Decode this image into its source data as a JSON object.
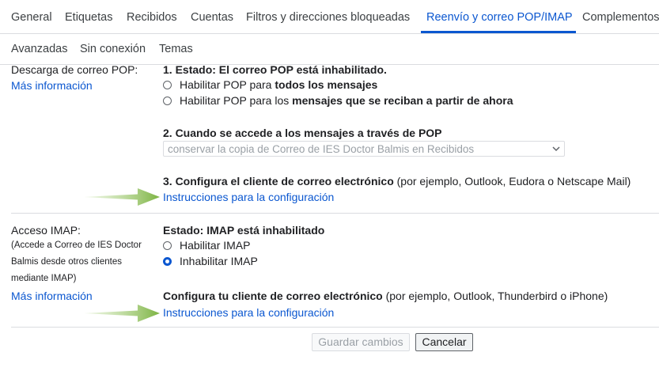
{
  "tabs": [
    {
      "label": "General",
      "active": false
    },
    {
      "label": "Etiquetas",
      "active": false
    },
    {
      "label": "Recibidos",
      "active": false
    },
    {
      "label": "Cuentas",
      "active": false
    },
    {
      "label": "Filtros y direcciones bloqueadas",
      "active": false
    },
    {
      "label": "Reenvío y correo POP/IMAP",
      "active": true
    },
    {
      "label": "Complementos",
      "active": false
    }
  ],
  "tabs_row2": [
    {
      "label": "Avanzadas"
    },
    {
      "label": "Sin conexión"
    },
    {
      "label": "Temas"
    }
  ],
  "pop": {
    "section_label": "Descarga de correo POP:",
    "more_info": "Más información",
    "status": "1. Estado: El correo POP está inhabilitado.",
    "option1_prefix": "Habilitar POP para ",
    "option1_bold": "todos los mensajes",
    "option2_prefix": "Habilitar POP para los ",
    "option2_bold": "mensajes que se reciban a partir de ahora",
    "access_heading": "2. Cuando se accede a los mensajes a través de POP",
    "access_select_value": "conservar la copia de Correo de IES Doctor Balmis en Recibidos",
    "configure_heading": "3. Configura el cliente de correo electrónico",
    "configure_note": " (por ejemplo, Outlook, Eudora o Netscape Mail)",
    "instructions_link": "Instrucciones para la configuración"
  },
  "imap": {
    "section_label": "Acceso IMAP:",
    "desc_lines": [
      "(Accede a Correo de IES Doctor",
      "Balmis desde otros clientes",
      "mediante IMAP)"
    ],
    "more_info": "Más información",
    "status": "Estado: IMAP está inhabilitado",
    "option_enable": "Habilitar IMAP",
    "option_disable": "Inhabilitar IMAP",
    "selected": "Inhabilitar IMAP",
    "configure_heading": "Configura tu cliente de correo electrónico",
    "configure_note": " (por ejemplo, Outlook, Thunderbird o iPhone)",
    "instructions_link": "Instrucciones para la configuración"
  },
  "actions": {
    "save_label": "Guardar cambios",
    "cancel_label": "Cancelar"
  },
  "colors": {
    "accent": "#0b57d0",
    "arrow": "#8bc34a",
    "divider": "#dadce0"
  }
}
